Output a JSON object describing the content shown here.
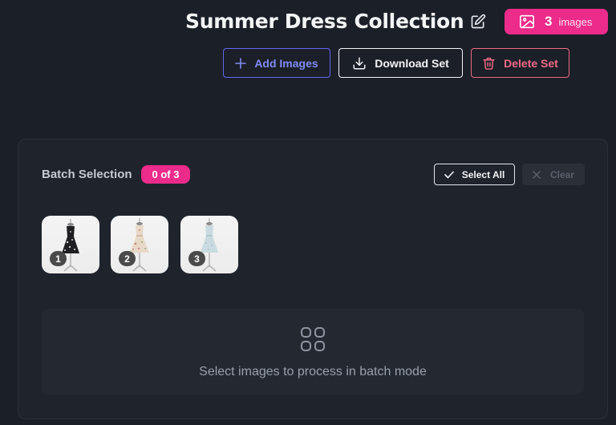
{
  "header": {
    "title": "Summer Dress Collection",
    "edit_icon": "pencil-edit-icon",
    "image_count": "3",
    "image_count_unit": "images",
    "image_count_icon": "image-icon"
  },
  "actions": {
    "add_label": "Add Images",
    "download_label": "Download Set",
    "delete_label": "Delete Set"
  },
  "batch": {
    "label": "Batch Selection",
    "selection_badge": "0 of 3",
    "select_all_label": "Select All",
    "clear_label": "Clear",
    "thumbnails": [
      {
        "number": "1",
        "dress_color": "#1f1f22",
        "pattern": "floral-dark"
      },
      {
        "number": "2",
        "dress_color": "#e9d9c8",
        "pattern": "floral-light"
      },
      {
        "number": "3",
        "dress_color": "#c9dbe0",
        "pattern": "pale-blue"
      }
    ],
    "empty_state_text": "Select images to process in batch mode",
    "empty_state_icon": "grid-apps-icon"
  },
  "colors": {
    "accent_pink": "#ec2b8b",
    "accent_indigo": "#6366f1",
    "danger": "#f06a86",
    "background": "#1b1f27"
  }
}
